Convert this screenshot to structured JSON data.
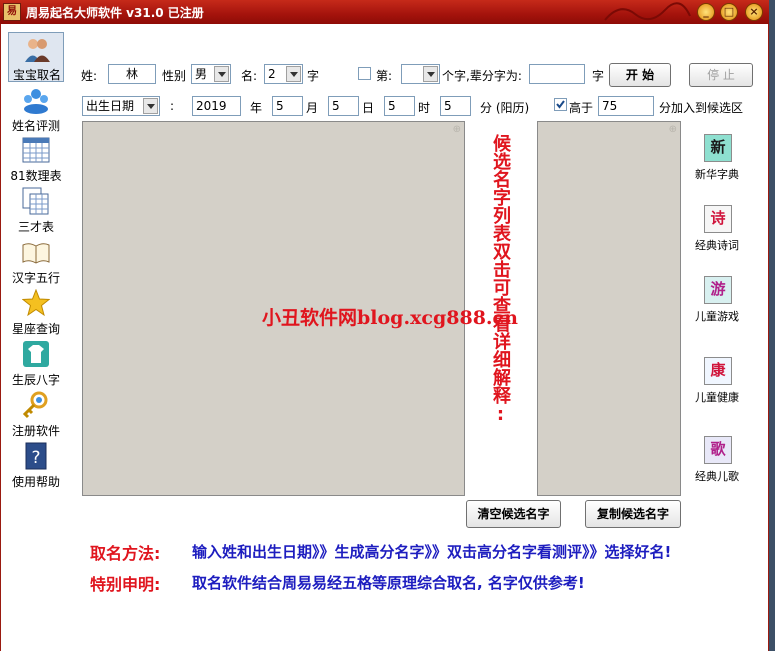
{
  "window": {
    "icon_char": "易",
    "title": "周易起名大师软件  v31.0  已注册",
    "min": "_",
    "max": "□",
    "close": "×"
  },
  "sidebar": {
    "items": [
      {
        "label": "宝宝取名"
      },
      {
        "label": "姓名评测"
      },
      {
        "label": "81数理表"
      },
      {
        "label": "三才表"
      },
      {
        "label": "汉字五行"
      },
      {
        "label": "星座查询"
      },
      {
        "label": "生辰八字"
      },
      {
        "label": "注册软件"
      },
      {
        "label": "使用帮助"
      }
    ]
  },
  "form": {
    "surname_label": "姓:",
    "surname_value": "林",
    "gender_label": "性别",
    "gender_value": "男",
    "name_label": "名:",
    "name_len_value": "2",
    "name_len_unit": "字",
    "position_label": "第:",
    "position_value": "",
    "position_unit": "个字,辈分字为:",
    "generation_value": "",
    "generation_unit": "字",
    "start_button": "开 始",
    "stop_button": "停 止",
    "date_type_value": "出生日期",
    "colon": ":",
    "year_value": "2019",
    "year_unit": "年",
    "month_value": "5",
    "month_unit": "月",
    "day_value": "5",
    "day_unit": "日",
    "hour_value": "5",
    "hour_unit": "时",
    "minute_value": "5",
    "minute_unit": "分 (阳历)",
    "above_label": "高于",
    "above_value": "75",
    "above_suffix": "分加入到候选区",
    "above_checked": true
  },
  "candidate_hint": "候选名字列表双击可查看详细解释:",
  "watermark": "小丑软件网blog.xcg888.cn",
  "tools": [
    {
      "char": "新",
      "label": "新华字典",
      "color": "#1a7a3a"
    },
    {
      "char": "诗",
      "label": "经典诗词",
      "color": "#d0143c"
    },
    {
      "char": "游",
      "label": "儿童游戏",
      "color": "#b0208a"
    },
    {
      "char": "康",
      "label": "儿童健康",
      "color": "#d0143c"
    },
    {
      "char": "歌",
      "label": "经典儿歌",
      "color": "#b0208a"
    }
  ],
  "buttons": {
    "clear": "清空候选名字",
    "copy": "复制候选名字"
  },
  "footer": {
    "method_title": "取名方法:",
    "method_text": "输入姓和出生日期》》生成高分名字》》双击高分名字看测评》》选择好名!",
    "notice_title": "特别申明:",
    "notice_text": "取名软件结合周易易经五格等原理综合取名, 名字仅供参考!"
  }
}
